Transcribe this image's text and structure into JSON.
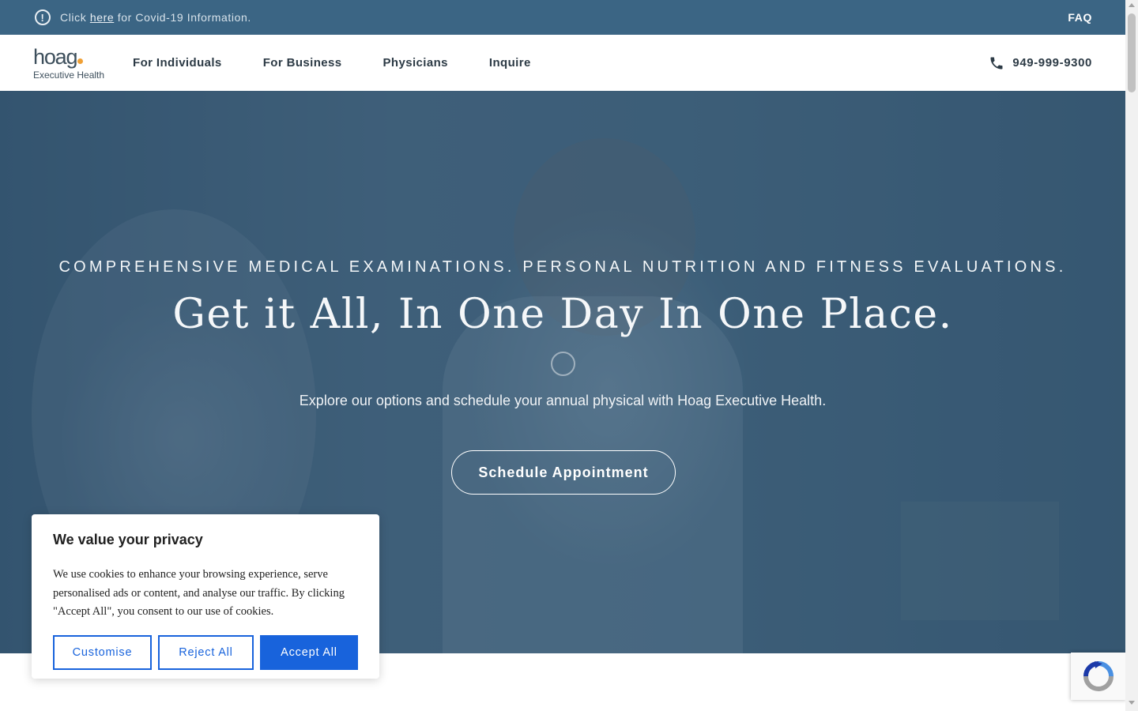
{
  "alert_bar": {
    "prefix": "Click",
    "link_text": "here",
    "suffix": "for Covid-19 Information.",
    "faq_label": "FAQ"
  },
  "nav": {
    "logo_text": "hoag",
    "logo_subtitle": "Executive Health",
    "items": [
      {
        "label": "For Individuals"
      },
      {
        "label": "For Business"
      },
      {
        "label": "Physicians"
      },
      {
        "label": "Inquire"
      }
    ],
    "phone": "949-999-9300"
  },
  "hero": {
    "eyebrow": "COMPREHENSIVE MEDICAL EXAMINATIONS. PERSONAL NUTRITION AND FITNESS EVALUATIONS.",
    "headline": "Get it All, In One Day In One Place.",
    "subline": "Explore our options and schedule your annual physical with Hoag Executive Health.",
    "cta_label": "Schedule Appointment"
  },
  "cookie_banner": {
    "title": "We value your privacy",
    "text": "We use cookies to enhance your browsing experience, serve personalised ads or content, and analyse our traffic. By clicking \"Accept All\", you consent to our use of cookies.",
    "customise_label": "Customise",
    "reject_label": "Reject All",
    "accept_label": "Accept All"
  },
  "colors": {
    "alert_bar_bg": "#3b6584",
    "logo_accent": "#f0a035",
    "cookie_button": "#1863dc",
    "hero_overlay": "#2d506e"
  },
  "icons": {
    "alert": "exclamation-circle-icon",
    "phone": "phone-icon",
    "recaptcha": "recaptcha-icon"
  }
}
